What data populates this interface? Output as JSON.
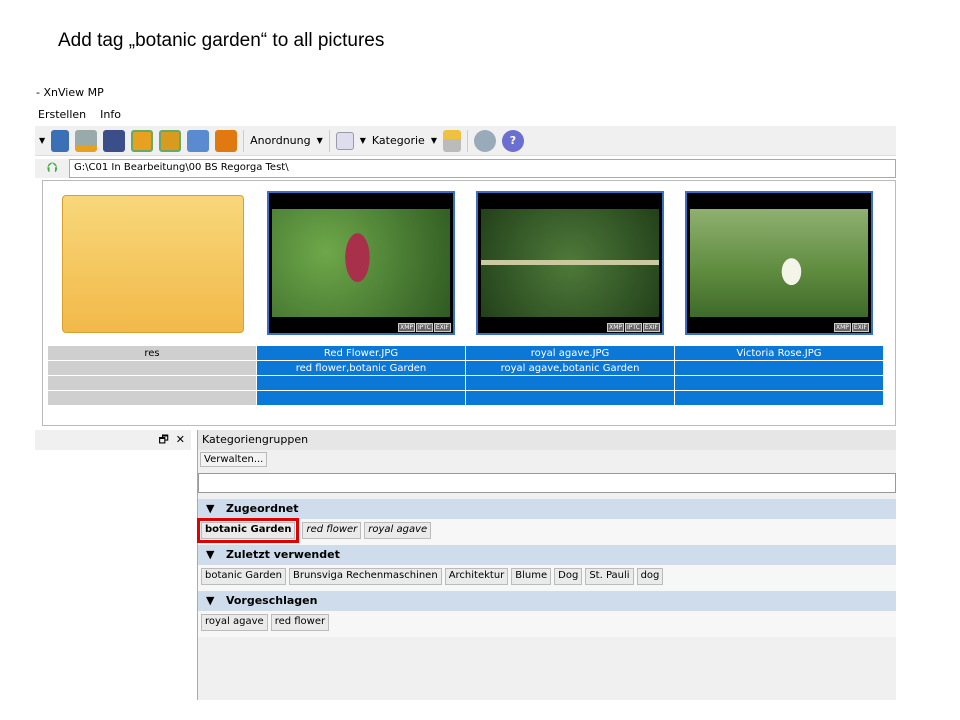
{
  "slide_title": "Add tag „botanic garden“ to all pictures",
  "window_title": "- XnView MP",
  "menu": [
    "Erstellen",
    "Info"
  ],
  "toolbar": {
    "arrange": "Anordnung",
    "category": "Kategorie"
  },
  "address": "G:\\C01 In Bearbeitung\\00 BS Regorga Test\\",
  "items": [
    {
      "name": "res",
      "tags": ""
    },
    {
      "name": "Red Flower.JPG",
      "tags": "red flower,botanic Garden"
    },
    {
      "name": "royal agave.JPG",
      "tags": "royal agave,botanic Garden"
    },
    {
      "name": "Victoria Rose.JPG",
      "tags": ""
    }
  ],
  "badges": [
    "XMP",
    "IPTC",
    "EXIF"
  ],
  "panel": {
    "title": "Kategoriengruppen",
    "manage": "Verwalten...",
    "search_value": ""
  },
  "sections": [
    {
      "title": "Zugeordnet",
      "tags": [
        "botanic Garden",
        "red flower",
        "royal agave"
      ]
    },
    {
      "title": "Zuletzt verwendet",
      "tags": [
        "botanic Garden",
        "Brunsviga Rechenmaschinen",
        "Architektur",
        "Blume",
        "Dog",
        "St. Pauli",
        "dog"
      ]
    },
    {
      "title": "Vorgeschlagen",
      "tags": [
        "royal agave",
        "red flower"
      ]
    }
  ],
  "highlight_color": "#e00000"
}
